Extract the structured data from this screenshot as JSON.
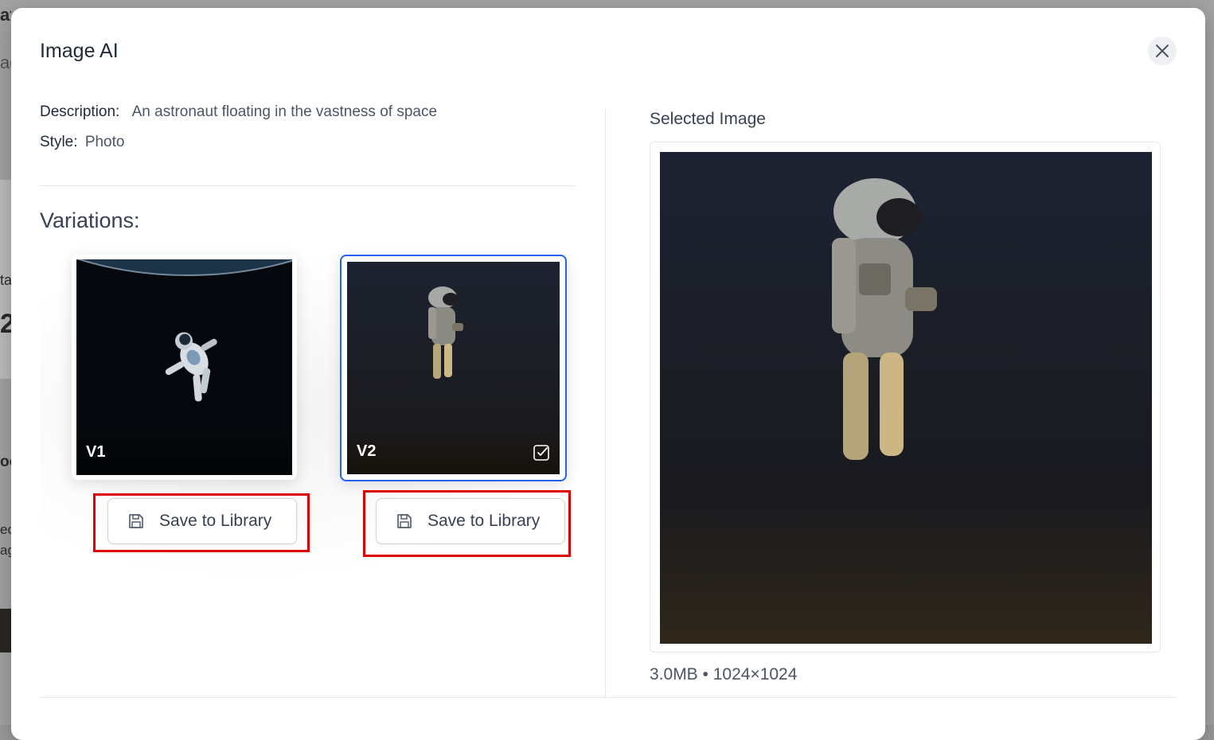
{
  "modal": {
    "title": "Image AI",
    "close_icon": "close-icon"
  },
  "details": {
    "description_label": "Description:",
    "description_value": "An astronaut floating in the vastness of space",
    "style_label": "Style:",
    "style_value": "Photo"
  },
  "variations": {
    "heading": "Variations:",
    "items": [
      {
        "label": "V1",
        "selected": false,
        "save_label": "Save to Library",
        "save_icon": "floppy-disk-icon"
      },
      {
        "label": "V2",
        "selected": true,
        "save_label": "Save to Library",
        "save_icon": "floppy-disk-icon",
        "check_icon": "checkbox-checked-icon"
      }
    ]
  },
  "selected_image": {
    "heading": "Selected Image",
    "file_info": "3.0MB • 1024×1024"
  },
  "background": {
    "fragments": [
      "ati",
      "ag",
      "ta",
      "2",
      "oo",
      "ec",
      "ag"
    ]
  },
  "colors": {
    "accent": "#2563eb",
    "highlight": "#e00000"
  }
}
